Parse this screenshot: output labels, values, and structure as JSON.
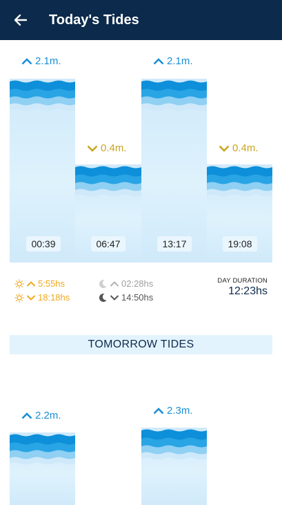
{
  "app_bar": {
    "title": "Today's Tides",
    "back_icon": "arrow-left-icon"
  },
  "colors": {
    "app_bar_bg": "#0c2a4b",
    "water_light": "#cfe9fa",
    "water_mid": "#8fd0f3",
    "water_wave": "#29a4e4",
    "water_wave_dark": "#0d8fd9",
    "high_tide_text": "#1a8fd6",
    "low_tide_text": "#c9a620",
    "sun_color": "#f0a81e",
    "moon_color": "#8a8a8a"
  },
  "today": {
    "tides": [
      {
        "type": "high",
        "height": "2.1m.",
        "time": "00:39"
      },
      {
        "type": "low",
        "height": "0.4m.",
        "time": "06:47"
      },
      {
        "type": "high",
        "height": "2.1m.",
        "time": "13:17"
      },
      {
        "type": "low",
        "height": "0.4m.",
        "time": "19:08"
      }
    ]
  },
  "sun_moon": {
    "sunrise": "5:55hs",
    "sunset": "18:18hs",
    "moonrise": "02:28hs",
    "moonset": "14:50hs"
  },
  "day_duration": {
    "label": "DAY DURATION",
    "value": "12:23hs"
  },
  "tomorrow": {
    "header": "TOMORROW TIDES",
    "tides": [
      {
        "type": "high",
        "height": "2.2m."
      },
      {
        "type": "high",
        "height": "2.3m."
      }
    ]
  }
}
